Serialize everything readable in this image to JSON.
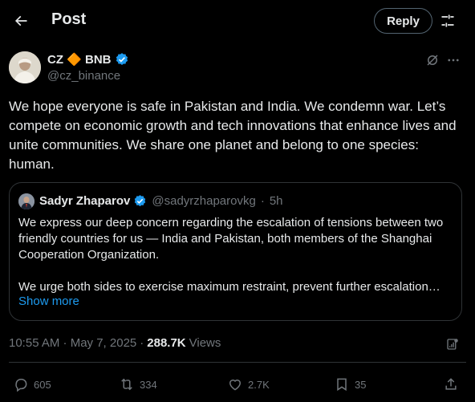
{
  "header": {
    "title": "Post",
    "reply_label": "Reply"
  },
  "author": {
    "name": "CZ 🔶 BNB",
    "handle": "@cz_binance"
  },
  "post": {
    "text": "We hope everyone is safe in Pakistan and India. We condemn war. Let’s compete on economic growth and tech innovations that enhance lives and unite communities. We share one planet and belong to one species: human."
  },
  "quote": {
    "name": "Sadyr Zhaparov",
    "handle": "@sadyrzhaparovkg",
    "separator": "·",
    "time": "5h",
    "paragraph1": "We express our deep concern regarding the escalation of tensions between two friendly countries for us — India and Pakistan, both members of the Shanghai Cooperation Organization.",
    "paragraph2": "We urge both sides to exercise maximum restraint, prevent further escalation…",
    "show_more": "Show more"
  },
  "meta": {
    "timestamp": "10:55 AM · May 7, 2025",
    "separator": "·",
    "views_count": "288.7K",
    "views_label": "Views"
  },
  "actions": {
    "replies": "605",
    "reposts": "334",
    "likes": "2.7K",
    "bookmarks": "35"
  },
  "colors": {
    "background": "#000000",
    "text": "#e7e9ea",
    "muted": "#71767b",
    "accent": "#1d9bf0",
    "border": "#2f3336",
    "verified": "#1d9bf0"
  },
  "icons": [
    "back-arrow-icon",
    "settings-icon",
    "verified-badge-icon",
    "grok-icon",
    "more-icon",
    "analytics-icon",
    "reply-icon",
    "repost-icon",
    "like-icon",
    "bookmark-icon",
    "share-icon"
  ]
}
